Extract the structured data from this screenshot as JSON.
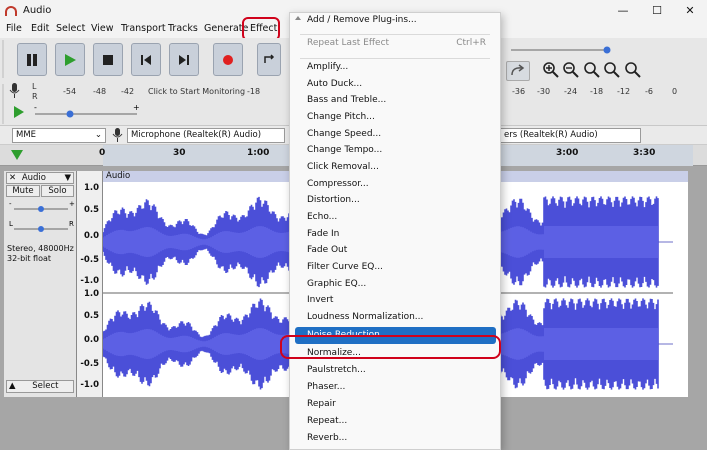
{
  "window": {
    "title": "Audio",
    "controls": [
      "—",
      "☐",
      "✕"
    ]
  },
  "menubar": [
    "File",
    "Edit",
    "Select",
    "View",
    "Transport",
    "Tracks",
    "Generate",
    "Effect"
  ],
  "toolbar": {
    "meter": {
      "lr": [
        "L",
        "R"
      ],
      "scale": [
        "-54",
        "-48",
        "-42",
        "-18"
      ],
      "monitor_text": "Click to Start Monitoring"
    },
    "right_scale": [
      "-36",
      "-30",
      "-24",
      "-18",
      "-12",
      "-6",
      "0"
    ]
  },
  "device_row": {
    "host": "MME",
    "mic": "Microphone (Realtek(R) Audio)",
    "speaker": "ers (Realtek(R) Audio)"
  },
  "timeline": {
    "ticks": [
      "0",
      "30",
      "1:00",
      "3:00",
      "3:30"
    ]
  },
  "track": {
    "name": "Audio",
    "clip_name": "Audio",
    "mute": "Mute",
    "solo": "Solo",
    "info": [
      "Stereo, 48000Hz",
      "32-bit float"
    ],
    "select": "Select",
    "scale": [
      "1.0",
      "0.5",
      "0.0",
      "-0.5",
      "-1.0",
      "1.0",
      "0.5",
      "0.0",
      "-0.5",
      "-1.0"
    ],
    "wave_color": "#4b4fd8"
  },
  "effect_menu": {
    "items": [
      {
        "label": "Add / Remove Plug-ins...",
        "shortcut": ""
      },
      {
        "label": "Repeat Last Effect",
        "shortcut": "Ctrl+R",
        "disabled": true
      },
      {
        "label": "Amplify...",
        "shortcut": ""
      },
      {
        "label": "Auto Duck...",
        "shortcut": ""
      },
      {
        "label": "Bass and Treble...",
        "shortcut": ""
      },
      {
        "label": "Change Pitch...",
        "shortcut": ""
      },
      {
        "label": "Change Speed...",
        "shortcut": ""
      },
      {
        "label": "Change Tempo...",
        "shortcut": ""
      },
      {
        "label": "Click Removal...",
        "shortcut": ""
      },
      {
        "label": "Compressor...",
        "shortcut": ""
      },
      {
        "label": "Distortion...",
        "shortcut": ""
      },
      {
        "label": "Echo...",
        "shortcut": ""
      },
      {
        "label": "Fade In",
        "shortcut": ""
      },
      {
        "label": "Fade Out",
        "shortcut": ""
      },
      {
        "label": "Filter Curve EQ...",
        "shortcut": ""
      },
      {
        "label": "Graphic EQ...",
        "shortcut": ""
      },
      {
        "label": "Invert",
        "shortcut": ""
      },
      {
        "label": "Loudness Normalization...",
        "shortcut": ""
      },
      {
        "label": "Noise Reduction...",
        "shortcut": "",
        "highlight": true
      },
      {
        "label": "Normalize...",
        "shortcut": ""
      },
      {
        "label": "Paulstretch...",
        "shortcut": ""
      },
      {
        "label": "Phaser...",
        "shortcut": ""
      },
      {
        "label": "Repair",
        "shortcut": ""
      },
      {
        "label": "Repeat...",
        "shortcut": ""
      },
      {
        "label": "Reverb...",
        "shortcut": ""
      }
    ],
    "highlight_color": "#1f6fc4",
    "annotation_color": "#d0021b"
  }
}
